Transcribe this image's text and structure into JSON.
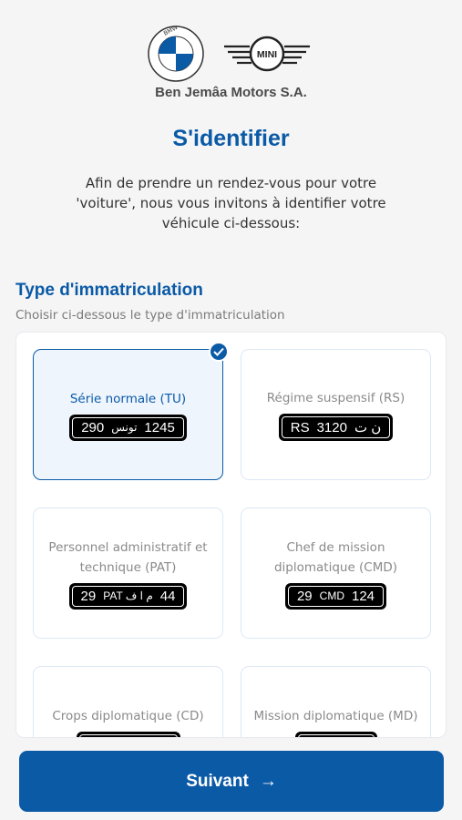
{
  "header": {
    "brand_bmw": "BMW",
    "brand_mini": "MINI",
    "company": "Ben Jemâa Motors S.A."
  },
  "page": {
    "title": "S'identifier",
    "intro": "Afin de prendre un rendez-vous pour votre 'voiture', nous vous invitons à identifier votre véhicule ci-dessous:"
  },
  "section": {
    "title": "Type d'immatriculation",
    "subtitle": "Choisir ci-dessous le type d'immatriculation"
  },
  "options": [
    {
      "label": "Série normale (TU)",
      "plate": {
        "left": "290",
        "mid": "تونس",
        "right": "1245"
      },
      "selected": true
    },
    {
      "label": "Régime suspensif (RS)",
      "plate": {
        "left": "RS",
        "mid": "3120",
        "right": "ن ت"
      },
      "selected": false
    },
    {
      "label": "Personnel administratif et technique (PAT)",
      "plate": {
        "left": "29",
        "mid": "PAT م ا ف",
        "right": "44"
      },
      "selected": false
    },
    {
      "label": "Chef de mission diplomatique (CMD)",
      "plate": {
        "left": "29",
        "mid": "CMD",
        "right": "124"
      },
      "selected": false
    },
    {
      "label": "Crops diplomatique (CD)",
      "plate": {
        "left": "",
        "mid": "",
        "right": ""
      },
      "selected": false
    },
    {
      "label": "Mission diplomatique (MD)",
      "plate": {
        "left": "",
        "mid": "",
        "right": ""
      },
      "selected": false
    }
  ],
  "footer": {
    "next_label": "Suivant",
    "next_icon": "→"
  },
  "colors": {
    "primary": "#0b5aa6",
    "background": "#f5f5f6",
    "selected_bg": "#eef5fd"
  }
}
